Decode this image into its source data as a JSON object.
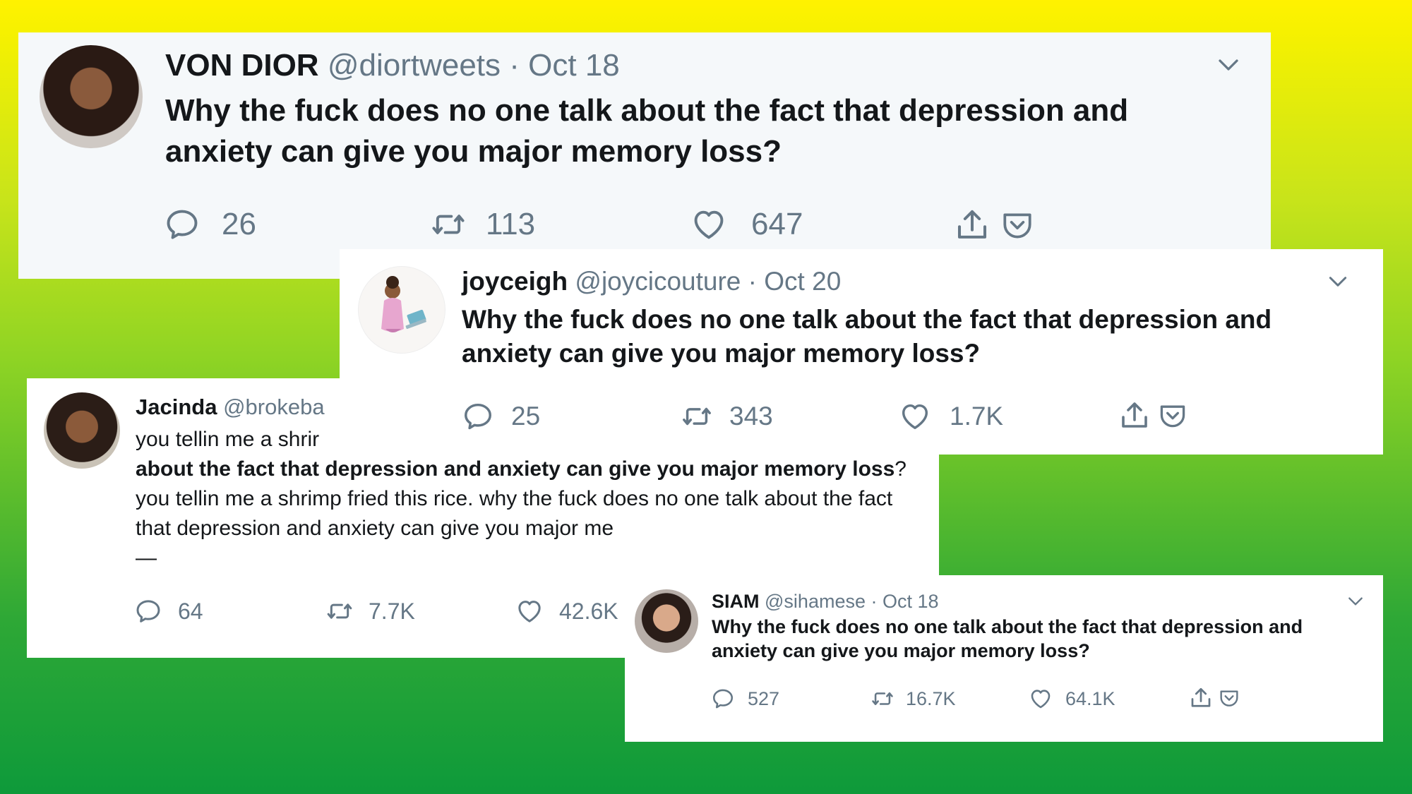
{
  "tweets": [
    {
      "name": "VON DIOR",
      "handle": "@diortweets",
      "sep": "·",
      "date": "Oct 18",
      "text": "Why the fuck does no one talk about the fact that depression and anxiety can give you major memory loss?",
      "replies": "26",
      "retweets": "113",
      "likes": "647",
      "avatar_icon": "avatar-photo"
    },
    {
      "name": "joyceigh",
      "handle": "@joycicouture",
      "sep": "·",
      "date": "Oct 20",
      "text": "Why the fuck does no one talk about the fact that depression and anxiety can give you major memory loss?",
      "replies": "25",
      "retweets": "343",
      "likes": "1.7K",
      "avatar_icon": "avatar-illustration"
    },
    {
      "name": "Jacinda",
      "handle": "@brokeba",
      "line1": "you tellin me a shrir",
      "bold": "about the fact that depression and anxiety can give you major memory loss",
      "rest_q": "?",
      "rest": " you tellin me a shrimp fried this rice. why the fuck does no one talk about the fact that depression and anxiety can give you major me",
      "dash": "—",
      "replies": "64",
      "retweets": "7.7K",
      "likes": "42.6K",
      "avatar_icon": "avatar-photo"
    },
    {
      "name": "SIAM",
      "handle": "@sihamese",
      "sep": "·",
      "date": "Oct 18",
      "text": "Why the fuck does no one talk about the fact that depression and anxiety can give you major memory loss?",
      "replies": "527",
      "retweets": "16.7K",
      "likes": "64.1K",
      "avatar_icon": "avatar-photo"
    }
  ],
  "colors": {
    "gradient_top": "#fff200",
    "gradient_bottom": "#0e9a3a",
    "text": "#14171a",
    "meta": "#657786",
    "card_grey": "#f5f8fa"
  }
}
